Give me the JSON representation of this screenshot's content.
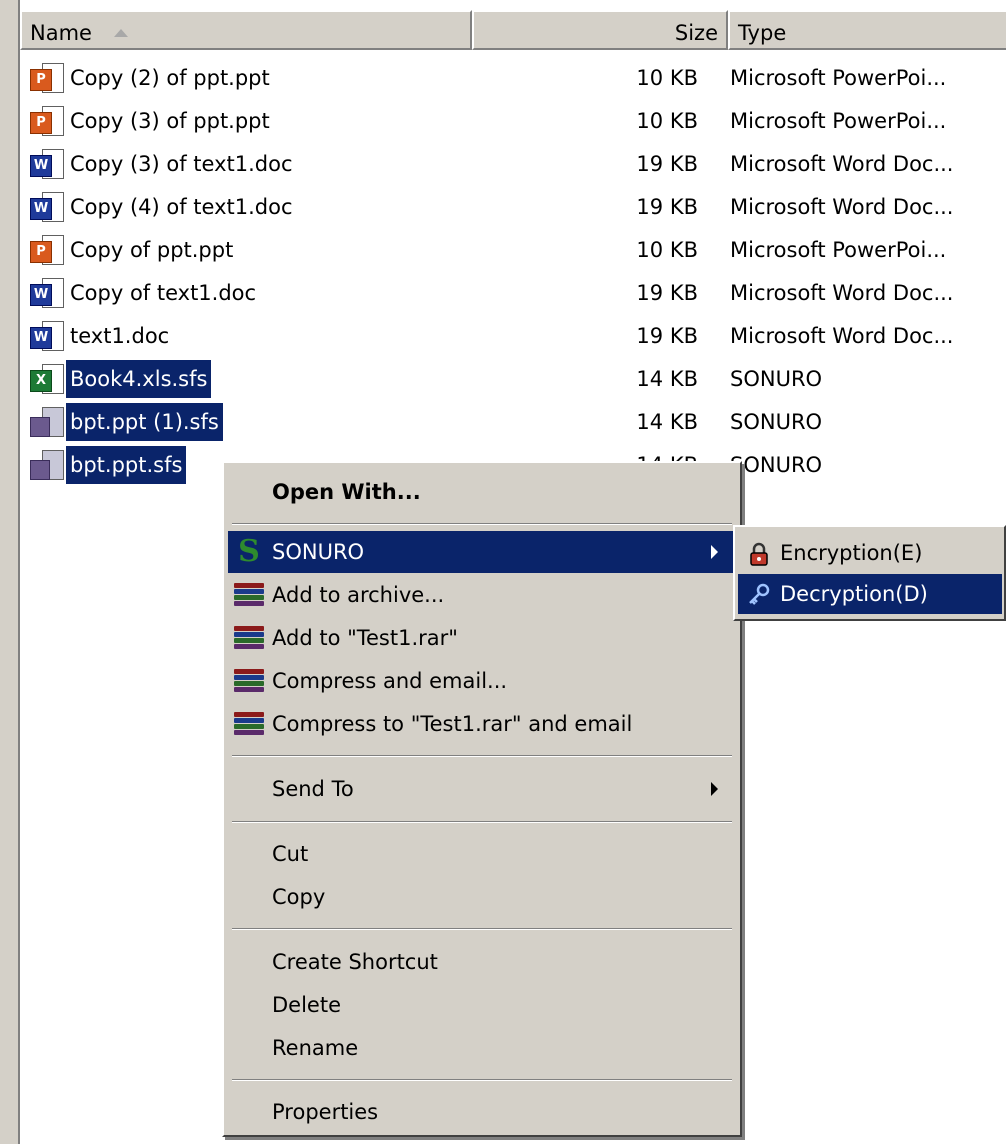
{
  "columns": {
    "name": "Name",
    "size": "Size",
    "type": "Type"
  },
  "files": [
    {
      "name": "Copy (2) of ppt.ppt",
      "size": "10 KB",
      "type": "Microsoft PowerPoi...",
      "icon": "ppt-file-icon",
      "selected": false
    },
    {
      "name": "Copy (3) of ppt.ppt",
      "size": "10 KB",
      "type": "Microsoft PowerPoi...",
      "icon": "ppt-file-icon",
      "selected": false
    },
    {
      "name": "Copy (3) of text1.doc",
      "size": "19 KB",
      "type": "Microsoft Word Doc...",
      "icon": "word-file-icon",
      "selected": false
    },
    {
      "name": "Copy (4) of text1.doc",
      "size": "19 KB",
      "type": "Microsoft Word Doc...",
      "icon": "word-file-icon",
      "selected": false
    },
    {
      "name": "Copy of ppt.ppt",
      "size": "10 KB",
      "type": "Microsoft PowerPoi...",
      "icon": "ppt-file-icon",
      "selected": false
    },
    {
      "name": "Copy of text1.doc",
      "size": "19 KB",
      "type": "Microsoft Word Doc...",
      "icon": "word-file-icon",
      "selected": false
    },
    {
      "name": "text1.doc",
      "size": "19 KB",
      "type": "Microsoft Word Doc...",
      "icon": "word-file-icon",
      "selected": false
    },
    {
      "name": "Book4.xls.sfs",
      "size": "14 KB",
      "type": "SONURO",
      "icon": "excel-sfs-file-icon",
      "selected": true
    },
    {
      "name": "bpt.ppt (1).sfs",
      "size": "14 KB",
      "type": "SONURO",
      "icon": "sfs-file-icon",
      "selected": true
    },
    {
      "name": "bpt.ppt.sfs",
      "size": "14 KB",
      "type": "SONURO",
      "icon": "sfs-file-icon",
      "selected": true
    }
  ],
  "context_menu": {
    "open_with": "Open With...",
    "sonuro": "SONURO",
    "add_to_archive": "Add to archive...",
    "add_to_rar": "Add to \"Test1.rar\"",
    "compress_email": "Compress and email...",
    "compress_rar_email": "Compress to \"Test1.rar\" and email",
    "send_to": "Send To",
    "cut": "Cut",
    "copy": "Copy",
    "create_shortcut": "Create Shortcut",
    "delete": "Delete",
    "rename": "Rename",
    "properties": "Properties"
  },
  "submenu": {
    "encryption": "Encryption(E)",
    "decryption": "Decryption(D)"
  },
  "colors": {
    "selection": "#0a246a",
    "menu_bg": "#d4d0c8",
    "sonuro_icon": "#2e8b2e"
  }
}
